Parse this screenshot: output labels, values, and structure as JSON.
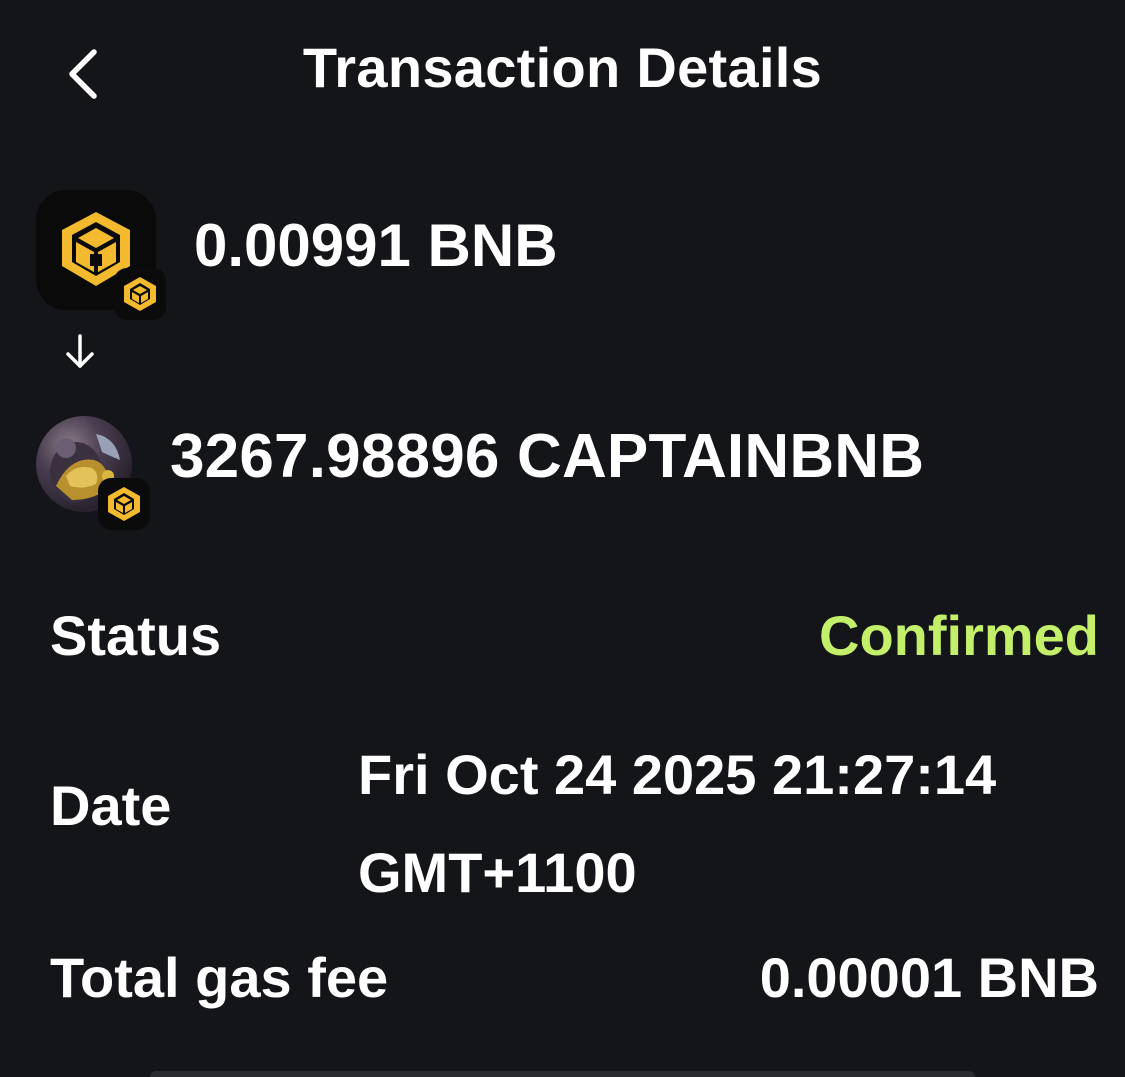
{
  "header": {
    "title": "Transaction Details",
    "back_icon": "chevron-left-icon"
  },
  "swap": {
    "from": {
      "amount": "0.00991 BNB",
      "token_icon": "bnb-icon",
      "chain_icon": "bnb-chain-icon"
    },
    "arrow_icon": "arrow-down-icon",
    "to": {
      "amount": "3267.98896 CAPTAINBNB",
      "token_icon": "captainbnb-avatar",
      "chain_icon": "bnb-chain-icon"
    }
  },
  "details": {
    "status_label": "Status",
    "status_value": "Confirmed",
    "date_label": "Date",
    "date_value": "Fri Oct 24 2025 21:27:14 GMT+1100",
    "gas_label": "Total gas fee",
    "gas_value": "0.00001 BNB"
  },
  "colors": {
    "background": "#141518",
    "text": "#ffffff",
    "status_confirmed": "#c4ef6b",
    "bnb_gold": "#f3ba2f"
  }
}
